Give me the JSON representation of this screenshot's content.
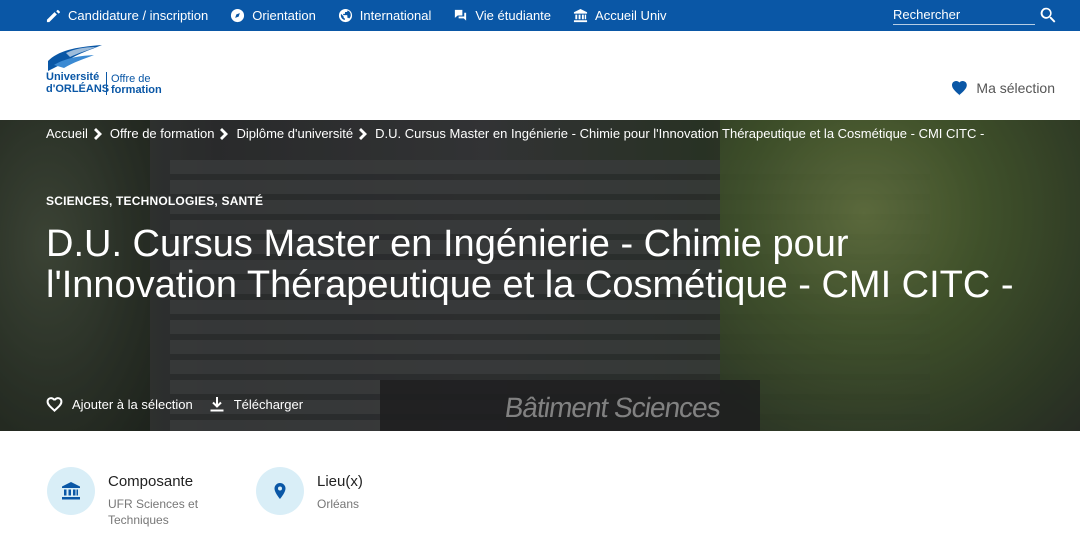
{
  "topbar": {
    "nav": [
      {
        "label": "Candidature / inscription",
        "icon": "pencil-icon"
      },
      {
        "label": "Orientation",
        "icon": "compass-icon"
      },
      {
        "label": "International",
        "icon": "globe-icon"
      },
      {
        "label": "Vie étudiante",
        "icon": "chat-icon"
      },
      {
        "label": "Accueil Univ",
        "icon": "university-icon"
      }
    ],
    "search_placeholder": "Rechercher",
    "search_icon": "search-icon",
    "bg_color": "#0a57a6"
  },
  "header": {
    "logo": {
      "line1": "Université",
      "line2": "d'ORLÉANS",
      "offre1": "Offre de",
      "offre2": "formation"
    },
    "selection_label": "Ma sélection",
    "selection_icon": "heart-icon"
  },
  "hero": {
    "breadcrumb": [
      "Accueil",
      "Offre de formation",
      "Diplôme d'université",
      "D.U. Cursus Master en Ingénierie - Chimie pour l'Innovation Thérapeutique et la Cosmétique - CMI CITC -"
    ],
    "category": "SCIENCES, TECHNOLOGIES, SANTÉ",
    "title": "D.U. Cursus Master en Ingénierie - Chimie pour l'Innovation Thérapeutique et la Cosmétique - CMI CITC -",
    "sign_text": "Bâtiment Sciences",
    "actions": {
      "add_label": "Ajouter à la sélection",
      "download_label": "Télécharger"
    }
  },
  "info": {
    "composante": {
      "label": "Composante",
      "value": "UFR Sciences et Techniques",
      "icon": "institution-icon"
    },
    "lieu": {
      "label": "Lieu(x)",
      "value": "Orléans",
      "icon": "location-pin-icon"
    },
    "circle_color": "#d9eef7"
  }
}
